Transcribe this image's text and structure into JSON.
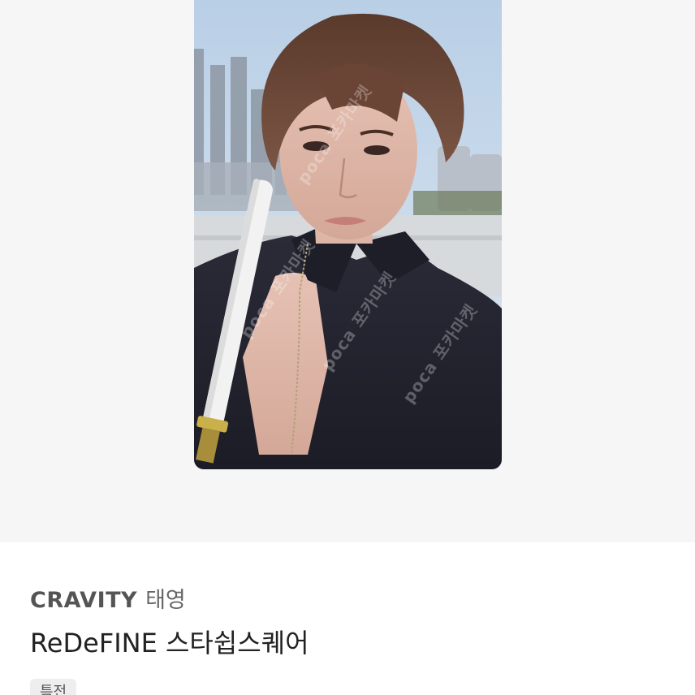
{
  "product": {
    "artist": "CRAVITY",
    "member": "태영",
    "title": "ReDeFINE 스타쉽스퀘어",
    "tag": "특전"
  },
  "image": {
    "subject": "photocard",
    "watermark_text": "poca 포카마켓"
  },
  "colors": {
    "hero_background": "#f6f6f6",
    "page_background": "#ffffff",
    "tag_background": "#eeeeee",
    "title_text": "#222222",
    "artist_text": "#555555"
  }
}
